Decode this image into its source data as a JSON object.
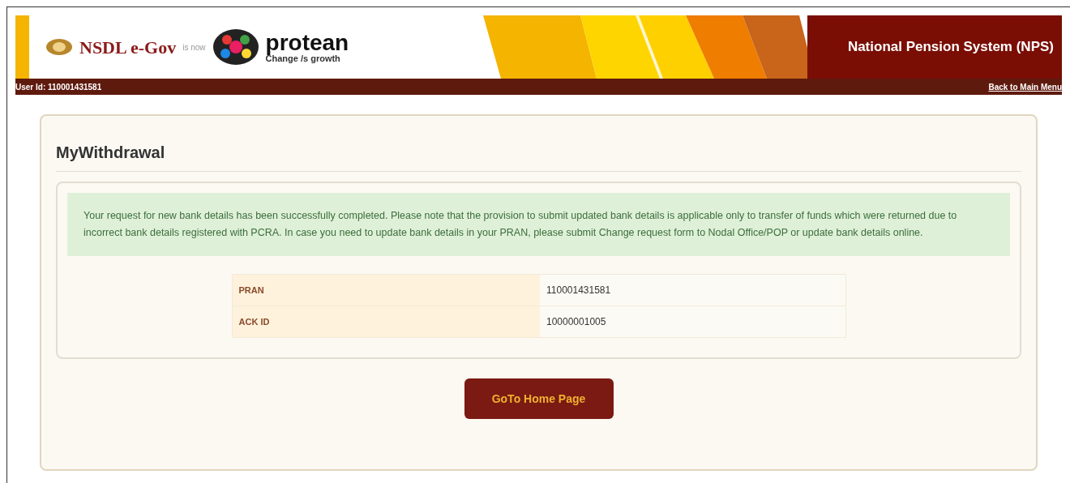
{
  "header": {
    "old_brand": "NSDL e-Gov",
    "connector": "is now",
    "new_brand": "protean",
    "tagline": "Change /s growth",
    "title": "National Pension System (NPS)",
    "user_id": "User Id: 110001431581",
    "back_link": "Back to Main Menu"
  },
  "page": {
    "heading": "MyWithdrawal",
    "message": "Your request for new bank details has been successfully completed. Please note that the provision to submit updated bank details is applicable only to transfer of funds which were returned due to incorrect bank details registered with PCRA. In case you need to update bank details in your PRAN, please submit Change request form to Nodal Office/POP or update bank details online.",
    "details": [
      {
        "label": "PRAN",
        "value": "110001431581"
      },
      {
        "label": "ACK ID",
        "value": "10000001005"
      }
    ],
    "button": "GoTo Home Page"
  }
}
